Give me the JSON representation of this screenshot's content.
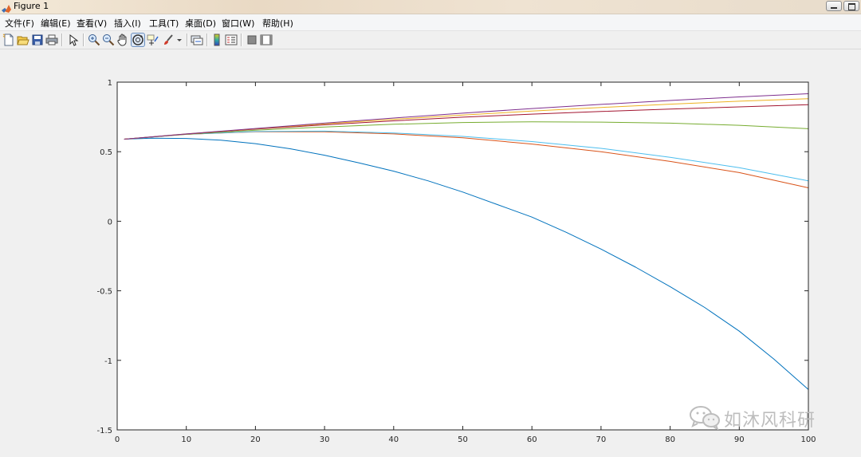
{
  "window": {
    "title": "Figure 1"
  },
  "menu": [
    {
      "label": "文件(F)"
    },
    {
      "label": "编辑(E)"
    },
    {
      "label": "查看(V)"
    },
    {
      "label": "插入(I)"
    },
    {
      "label": "工具(T)"
    },
    {
      "label": "桌面(D)"
    },
    {
      "label": "窗口(W)"
    },
    {
      "label": "帮助(H)"
    }
  ],
  "toolbar": {
    "icons": [
      "new-figure-icon",
      "open-file-icon",
      "save-icon",
      "print-icon",
      "pointer-icon",
      "zoom-in-icon",
      "zoom-out-icon",
      "pan-icon",
      "rotate-3d-icon",
      "data-cursor-icon",
      "brush-icon",
      "link-plot-icon",
      "colorbar-icon",
      "legend-icon",
      "hide-plot-tools-icon",
      "show-plot-tools-icon"
    ],
    "active": "rotate-3d-icon"
  },
  "colors": {
    "blue": "#0072BD",
    "red": "#D95319",
    "yellow": "#EDB120",
    "purple": "#7E2F8E",
    "green": "#77AC30",
    "cyan": "#4DBEEE",
    "maroon": "#A2142F"
  },
  "watermark": {
    "text": "如沐风科研"
  },
  "chart_data": {
    "type": "line",
    "title": "",
    "xlabel": "",
    "ylabel": "",
    "xlim": [
      0,
      100
    ],
    "ylim": [
      -1.5,
      1
    ],
    "xticks": [
      0,
      10,
      20,
      30,
      40,
      50,
      60,
      70,
      80,
      90,
      100
    ],
    "yticks": [
      1,
      0.5,
      0,
      -0.5,
      -1,
      -1.5
    ],
    "xtick_labels": [
      "0",
      "10",
      "20",
      "30",
      "40",
      "50",
      "60",
      "70",
      "80",
      "90",
      "100"
    ],
    "ytick_labels": [
      "1",
      "0.5",
      "0",
      "-0.5",
      "-1",
      "-1.5"
    ],
    "grid": false,
    "series": [
      {
        "color": "#0072BD",
        "x": [
          1,
          5,
          10,
          15,
          20,
          25,
          30,
          35,
          40,
          45,
          50,
          55,
          60,
          65,
          70,
          75,
          80,
          85,
          90,
          95,
          100
        ],
        "y": [
          0.59,
          0.597,
          0.595,
          0.583,
          0.558,
          0.521,
          0.475,
          0.42,
          0.36,
          0.29,
          0.21,
          0.12,
          0.03,
          -0.08,
          -0.2,
          -0.33,
          -0.47,
          -0.62,
          -0.79,
          -0.99,
          -1.21
        ]
      },
      {
        "color": "#D95319",
        "x": [
          1,
          10,
          20,
          30,
          40,
          50,
          60,
          70,
          80,
          90,
          100
        ],
        "y": [
          0.59,
          0.625,
          0.643,
          0.643,
          0.628,
          0.6,
          0.555,
          0.5,
          0.43,
          0.35,
          0.24
        ]
      },
      {
        "color": "#4DBEEE",
        "x": [
          1,
          10,
          20,
          30,
          40,
          50,
          60,
          70,
          80,
          90,
          100
        ],
        "y": [
          0.59,
          0.625,
          0.645,
          0.648,
          0.635,
          0.61,
          0.573,
          0.524,
          0.46,
          0.385,
          0.29
        ]
      },
      {
        "color": "#77AC30",
        "x": [
          1,
          10,
          20,
          30,
          40,
          50,
          60,
          70,
          80,
          90,
          100
        ],
        "y": [
          0.59,
          0.625,
          0.655,
          0.678,
          0.697,
          0.71,
          0.715,
          0.713,
          0.705,
          0.69,
          0.665
        ]
      },
      {
        "color": "#A2142F",
        "x": [
          1,
          10,
          20,
          30,
          40,
          50,
          60,
          70,
          80,
          90,
          100
        ],
        "y": [
          0.59,
          0.627,
          0.662,
          0.693,
          0.722,
          0.748,
          0.77,
          0.789,
          0.806,
          0.822,
          0.838
        ]
      },
      {
        "color": "#EDB120",
        "x": [
          1,
          10,
          20,
          30,
          40,
          50,
          60,
          70,
          80,
          90,
          100
        ],
        "y": [
          0.59,
          0.628,
          0.665,
          0.7,
          0.733,
          0.764,
          0.792,
          0.818,
          0.842,
          0.863,
          0.881
        ]
      },
      {
        "color": "#7E2F8E",
        "x": [
          1,
          10,
          20,
          30,
          40,
          50,
          60,
          70,
          80,
          90,
          100
        ],
        "y": [
          0.59,
          0.628,
          0.667,
          0.705,
          0.742,
          0.777,
          0.81,
          0.84,
          0.868,
          0.894,
          0.917
        ]
      }
    ]
  }
}
